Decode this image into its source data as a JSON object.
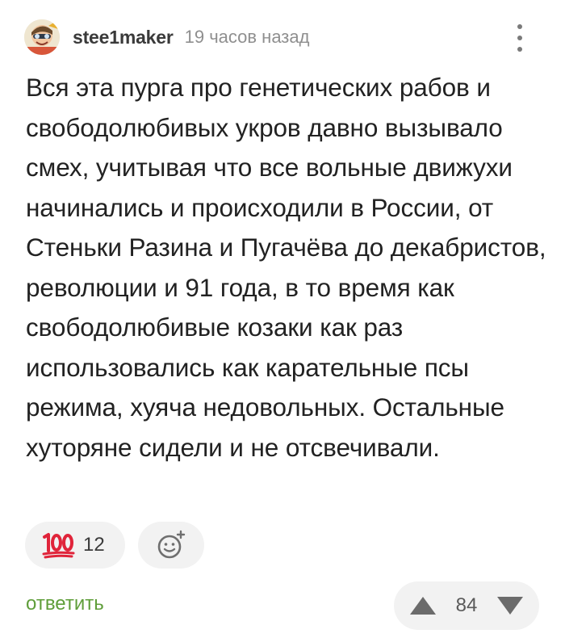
{
  "comment": {
    "author": {
      "username": "stee1maker",
      "avatar_icon": "avatar-cartoon-icon"
    },
    "timestamp": "19 часов назад",
    "more_icon": "vertical-dots-icon",
    "body": "Вся эта пурга про генетических рабов и свободолюбивых укров давно вызывало смех, учитывая что все вольные движухи начинались и происходили в России, от Стеньки Разина и Пугачёва до декабристов, революции и 91 года, в то время как свободолюбивые козаки как раз использовались как карательные псы режима, хуяча недовольных. Остальные хуторяне сидели и не отсвечивали.",
    "reactions": [
      {
        "icon": "hundred-points-icon",
        "count": "12"
      }
    ],
    "add_reaction_icon": "add-emoji-icon",
    "reply_label": "ответить",
    "rating": {
      "value": "84",
      "upvote_icon": "triangle-up-icon",
      "downvote_icon": "triangle-down-icon"
    }
  },
  "colors": {
    "reply_green": "#5f9e3a",
    "pill_background": "#f2f2f2",
    "emoji_red": "#e0243a"
  }
}
